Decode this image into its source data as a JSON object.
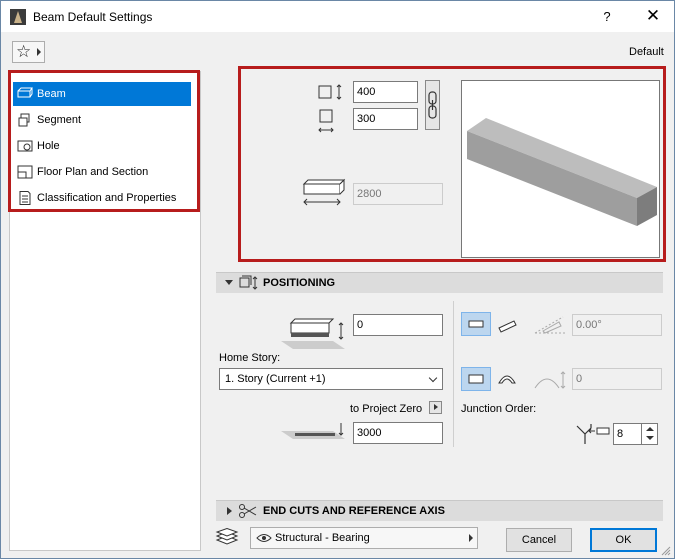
{
  "window": {
    "title": "Beam Default Settings",
    "help_label": "?",
    "close_label": "✕"
  },
  "header": {
    "default_label": "Default"
  },
  "sidebar": {
    "items": [
      {
        "label": "Beam",
        "icon": "beam-icon",
        "selected": true
      },
      {
        "label": "Segment",
        "icon": "segment-icon",
        "selected": false
      },
      {
        "label": "Hole",
        "icon": "hole-icon",
        "selected": false
      },
      {
        "label": "Floor Plan and Section",
        "icon": "floor-plan-icon",
        "selected": false
      },
      {
        "label": "Classification and Properties",
        "icon": "properties-icon",
        "selected": false
      }
    ]
  },
  "geometry": {
    "height_value": "400",
    "width_value": "300",
    "length_value": "2800"
  },
  "positioning": {
    "header": "POSITIONING",
    "offset_value": "0",
    "home_story_label": "Home Story:",
    "home_story_value": "1. Story (Current +1)",
    "reference_label": "to Project Zero",
    "elevation_value": "3000",
    "slant_value": "0.00°",
    "curve_value": "0",
    "junction_label": "Junction Order:",
    "junction_value": "8"
  },
  "end_cuts": {
    "header": "END CUTS AND REFERENCE AXIS"
  },
  "footer": {
    "structural_label": "Structural - Bearing",
    "cancel_label": "Cancel",
    "ok_label": "OK"
  },
  "colors": {
    "accent": "#0078d7",
    "highlight_border": "#b71c1c",
    "beam_gray": "#9e9e9e"
  }
}
